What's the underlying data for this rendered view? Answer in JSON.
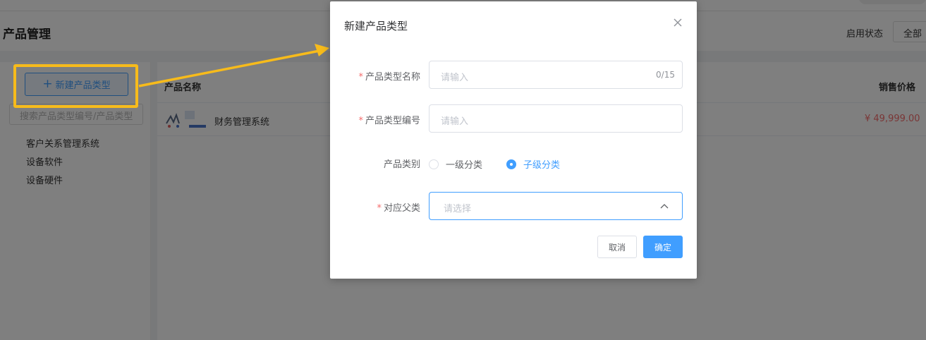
{
  "page": {
    "title": "产品管理",
    "status_label": "启用状态",
    "status_value": "全部"
  },
  "sidebar": {
    "new_button_label": "新建产品类型",
    "search_placeholder": "搜索产品类型编号/产品类型",
    "items": [
      {
        "label": "客户关系管理系统"
      },
      {
        "label": "设备软件"
      },
      {
        "label": "设备硬件"
      }
    ]
  },
  "table": {
    "columns": {
      "name": "产品名称",
      "price": "销售价格"
    },
    "rows": [
      {
        "name": "财务管理系统",
        "price": "¥ 49,999.00"
      }
    ]
  },
  "modal": {
    "title": "新建产品类型",
    "fields": {
      "type_name": {
        "label": "产品类型名称",
        "placeholder": "请输入",
        "counter": "0/15",
        "required": true
      },
      "type_code": {
        "label": "产品类型编号",
        "placeholder": "请输入",
        "required": true
      },
      "category": {
        "label": "产品类别",
        "options": [
          "一级分类",
          "子级分类"
        ],
        "selected": "子级分类"
      },
      "parent": {
        "label": "对应父类",
        "placeholder": "请选择",
        "required": true
      }
    },
    "cancel_label": "取消",
    "ok_label": "确定"
  },
  "required_mark": "*",
  "colors": {
    "primary": "#409eff",
    "danger": "#f56c6c",
    "annotation": "#f7bb1b"
  }
}
